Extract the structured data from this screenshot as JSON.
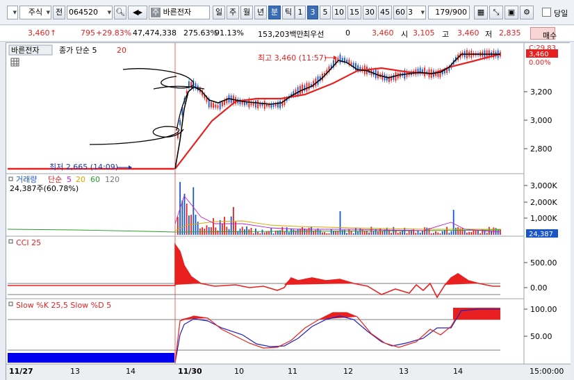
{
  "toolbar": {
    "market": "주식",
    "prefix": "전",
    "code": "064520",
    "stock_name_tag": "주",
    "stock_name": "바른전자",
    "periods": [
      "일",
      "주",
      "월",
      "년",
      "분",
      "틱"
    ],
    "selected_period": "분",
    "intervals": [
      "1",
      "3",
      "5",
      "10",
      "15",
      "30",
      "45",
      "60"
    ],
    "selected_interval": "3",
    "interval_value": "3",
    "count": "179/900",
    "checkbox_label": "당일"
  },
  "quote": {
    "price": "3,460",
    "change": "795",
    "change_pct": "+29.83%",
    "volume": "47,474,338",
    "volume_pct": "275.63%",
    "turnover": "91.13%",
    "amount": "153,203백만",
    "priority_label": "최우선",
    "priority_value": "0",
    "last": "3,460",
    "open_label": "시",
    "open": "3,105",
    "high_label": "고",
    "high": "3,460",
    "low_label": "저",
    "low": "2,835",
    "button_label": "매수"
  },
  "price_panel": {
    "stock": "바른전자",
    "ma_label": "종가 단순 5",
    "ma_value": "20",
    "high_annotation": "최고 3,460 (11:57)",
    "low_annotation": "최저 2,665 (14:09)",
    "current_tag": "3,460",
    "current_pct": "0.00%",
    "top_axis": "C:29.83",
    "axis": [
      "3,200",
      "3,000",
      "2,800"
    ]
  },
  "volume_panel": {
    "title": "거래량",
    "ma_prefix": "단순",
    "ma": [
      "5",
      "20",
      "60",
      "120"
    ],
    "value_label": "24,387주(60.78%)",
    "axis": [
      "3,000K",
      "2,000K",
      "1,000K"
    ],
    "current_tag": "24,387"
  },
  "cci_panel": {
    "title": "CCI 25",
    "axis": [
      "500.00",
      "0.00"
    ]
  },
  "stoch_panel": {
    "title": "Slow %K 25,5  Slow %D 5",
    "axis": [
      "100.00",
      "50.00"
    ]
  },
  "time_axis": {
    "labels": [
      "11/27",
      "13",
      "14",
      "11/30",
      "10",
      "11",
      "12",
      "13",
      "14"
    ],
    "right_label": "15:00:00"
  },
  "colors": {
    "up": "#e8201f",
    "down": "#1a56c8",
    "accent": "#3b6db5"
  }
}
